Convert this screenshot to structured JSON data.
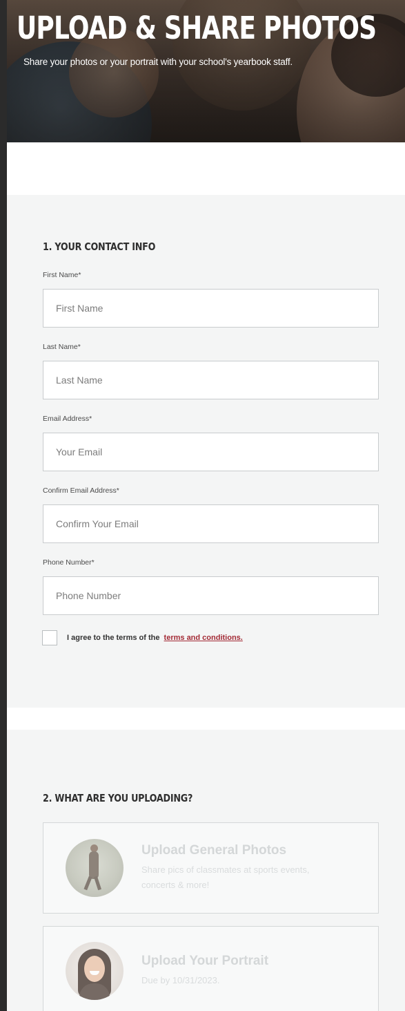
{
  "hero": {
    "title": "UPLOAD & SHARE PHOTOS",
    "subtitle": "Share your photos or your portrait with your school's yearbook staff."
  },
  "contact": {
    "heading": "1. YOUR CONTACT INFO",
    "first_name": {
      "label": "First Name*",
      "placeholder": "First Name",
      "value": ""
    },
    "last_name": {
      "label": "Last Name*",
      "placeholder": "Last Name",
      "value": ""
    },
    "email": {
      "label": "Email Address*",
      "placeholder": "Your Email",
      "value": ""
    },
    "confirm_email": {
      "label": "Confirm Email Address*",
      "placeholder": "Confirm Your Email",
      "value": ""
    },
    "phone": {
      "label": "Phone Number*",
      "placeholder": "Phone Number",
      "value": ""
    },
    "agree_text": "I agree to the terms of the",
    "agree_link": "terms and conditions.",
    "agree_checked": false
  },
  "uploading": {
    "heading": "2. WHAT ARE YOU UPLOADING?",
    "options": [
      {
        "title": "Upload General Photos",
        "description": "Share pics of classmates at sports events, concerts & more!",
        "icon": "runner-photo-icon"
      },
      {
        "title": "Upload Your Portrait",
        "description": "Due by 10/31/2023.",
        "icon": "portrait-photo-icon"
      }
    ]
  },
  "colors": {
    "link": "#a32a35",
    "section_bg": "#f4f5f5",
    "frame": "#2b2b2b"
  }
}
